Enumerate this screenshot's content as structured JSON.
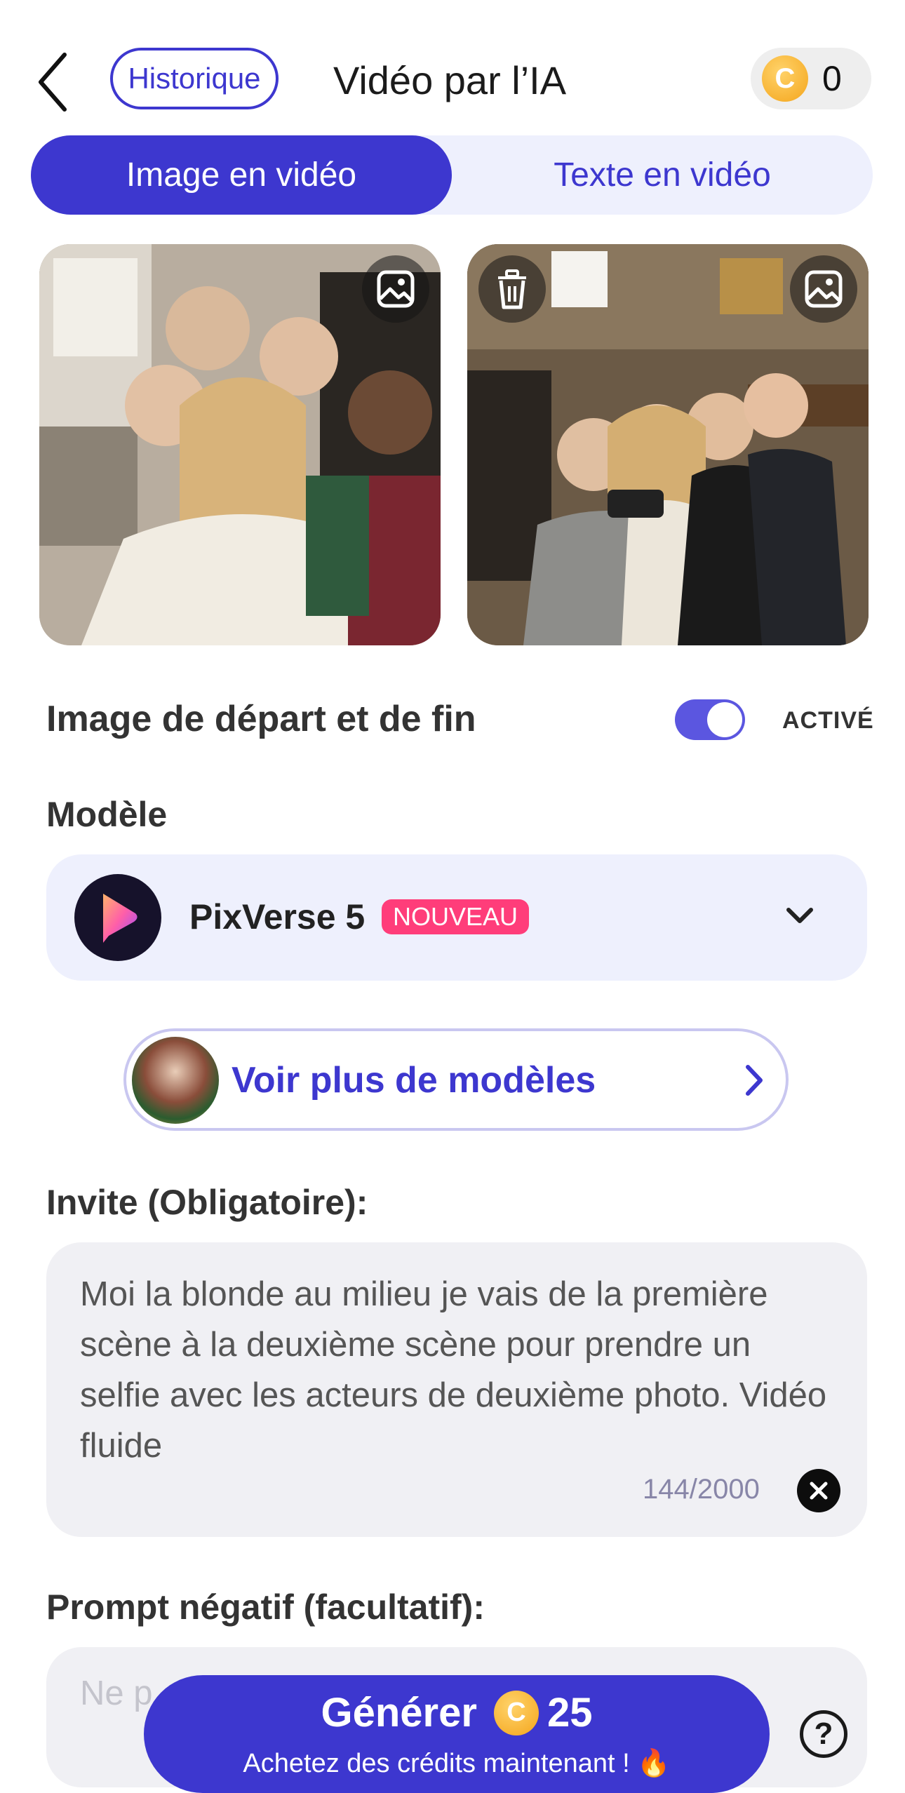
{
  "header": {
    "history_label": "Historique",
    "title": "Vidéo par l’IA",
    "coin_balance": "0",
    "coin_symbol": "C"
  },
  "tabs": [
    {
      "label": "Image en vidéo",
      "active": true
    },
    {
      "label": "Texte en vidéo",
      "active": false
    }
  ],
  "images": {
    "left_icons": [
      "image-icon"
    ],
    "right_icons": [
      "trash-icon",
      "image-icon"
    ]
  },
  "start_end": {
    "label": "Image de départ et de fin",
    "state": "ACTIVÉ",
    "enabled": true
  },
  "model": {
    "section_label": "Modèle",
    "name": "PixVerse 5",
    "badge": "NOUVEAU",
    "more_label": "Voir plus de modèles"
  },
  "prompt": {
    "label": "Invite (Obligatoire):",
    "value": "Moi la blonde au milieu je vais de la première scène à la deuxième scène pour prendre un selfie avec les acteurs de deuxième photo. Vidéo fluide",
    "counter": "144/2000"
  },
  "negative_prompt": {
    "label": "Prompt négatif (facultatif):",
    "placeholder": "Ne p"
  },
  "generate": {
    "label": "Générer",
    "coin_symbol": "C",
    "cost": "25",
    "subtitle": "Achetez des crédits maintenant ! 🔥"
  },
  "help": {
    "symbol": "?"
  },
  "colors": {
    "accent": "#3d37cf",
    "accent_light": "#eef0fd",
    "badge": "#ff3d7a",
    "coin": "#f4a51c"
  }
}
